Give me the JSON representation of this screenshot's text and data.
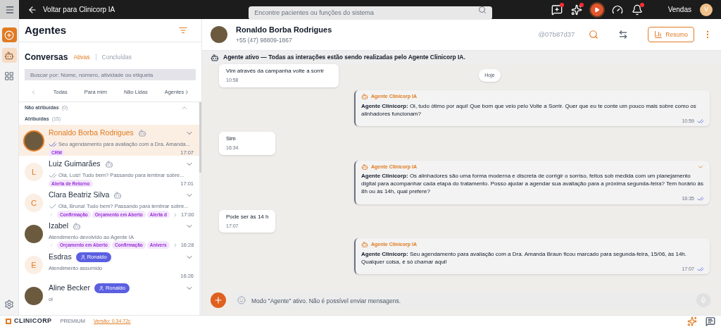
{
  "topbar": {
    "back_label": "Voltar para Clinicorp IA",
    "search_placeholder": "Encontre pacientes ou funções do sistema",
    "user": "Vendas",
    "avatar_letter": "V"
  },
  "rail": [
    {
      "kind": "agent",
      "selected": true
    },
    {
      "kind": "grid",
      "selected": false
    }
  ],
  "list": {
    "title": "Agentes",
    "section": "Conversas",
    "filters": [
      {
        "label": "Ativas",
        "selected": true
      },
      {
        "label": "Concluídas",
        "selected": false
      }
    ],
    "search_placeholder": "Buscar por: Nome, número, atividade ou etiqueta",
    "tabs": [
      {
        "label": "Todas",
        "selected": false
      },
      {
        "label": "Para mim",
        "selected": false
      },
      {
        "label": "Não Lidas",
        "selected": false
      },
      {
        "label": "Agentes",
        "selected": false
      }
    ],
    "groups": [
      {
        "label": "Não atribuídas",
        "count": "(0)",
        "expanded": false
      },
      {
        "label": "Atribuídas",
        "count": "(15)",
        "expanded": true,
        "conversations": [
          {
            "name": "Ronaldo Borba Rodrigues",
            "avatar": {
              "kind": "photo"
            },
            "agent": true,
            "status": {
              "kind": "read"
            },
            "preview": "Seu agendamento para avaliação com a Dra. Amanda...",
            "tags": [
              "CRM"
            ],
            "tags_scroll": false,
            "time": "17:07",
            "selected": true
          },
          {
            "name": "Luiz Guimarães",
            "avatar": {
              "kind": "letter",
              "letter": "L"
            },
            "agent": true,
            "status": {
              "kind": "delivered"
            },
            "preview": "Olá, Luiz! Tudo bem? Passando para lembrar sobre...",
            "tags": [
              "Alerta de Retorno"
            ],
            "tags_scroll": false,
            "time": "17:01",
            "selected": false
          },
          {
            "name": "Clara Beatriz Silva",
            "avatar": {
              "kind": "letter",
              "letter": "C"
            },
            "agent": true,
            "status": {
              "kind": "sent"
            },
            "preview": "Olá, Bruna! Tudo bem? Passando para lembrar sobre...",
            "tags": [
              "Confirmação",
              "Orçamento em Aberto",
              "Alerta d"
            ],
            "tags_scroll": true,
            "time": "17:00",
            "selected": false
          },
          {
            "name": "Izabel",
            "avatar": {
              "kind": "photo"
            },
            "agent": true,
            "preview": "Atendimento devolvido ao Agente IA",
            "tags": [
              "Orçamento em Aberto",
              "Confirmação",
              "Anivers"
            ],
            "tags_scroll": true,
            "time": "16:28",
            "selected": false
          },
          {
            "name": "Esdras",
            "avatar": {
              "kind": "letter",
              "letter": "E"
            },
            "agent": false,
            "assignee": "Ronaldo",
            "preview": "Atendimento assumido",
            "tags_scroll": false,
            "time": "16:26",
            "selected": false
          },
          {
            "name": "Aline Becker",
            "avatar": {
              "kind": "photo"
            },
            "agent": false,
            "assignee": "Ronaldo",
            "preview": "oi",
            "tags_scroll": false,
            "selected": false
          }
        ]
      }
    ]
  },
  "chat": {
    "name": "Ronaldo Borba Rodrigues",
    "phone": "+55 (47) 98809-1867",
    "handle": "@07b87d37",
    "summary_button": "Resumo",
    "banner": "Agente ativo — Todas as interações estão sendo realizadas pelo Agente Clinicorp IA.",
    "messages": [
      {
        "kind": "incoming",
        "text": "Vim  através da campanha volte a sorrir",
        "time": "10:58"
      },
      {
        "kind": "date",
        "text": "Hoje"
      },
      {
        "kind": "agent",
        "sender": "Agente Clinicorp IA",
        "text": "**Agente Clinicorp:** Oi, tudo ótimo por aqui! Que bom que veio pelo Volte a Sorrir. Quer que eu te conte um pouco mais sobre como os alinhadores funcionam?",
        "time": "10:59",
        "menu": false
      },
      {
        "kind": "incoming",
        "text": "Sim",
        "time": "16:34"
      },
      {
        "kind": "agent",
        "sender": "Agente Clinicorp IA",
        "text": "**Agente Clinicorp:** Os alinhadores são uma forma moderna e discreta de corrigir o sorriso, feitos sob medida com um planejamento digital para acompanhar cada etapa do tratamento. Posso ajudar a agendar sua avaliação para a próxima segunda-feira? Tem horário às 8h ou às 14h, qual prefere?",
        "time": "16:35",
        "menu": true
      },
      {
        "kind": "incoming",
        "text": "Pode ser às 14 h",
        "time": "17:07"
      },
      {
        "kind": "agent",
        "sender": "Agente Clinicorp IA",
        "text": "**Agente Clinicorp:** Seu agendamento para avaliação com a Dra. Amanda Braun ficou marcado para segunda-feira, 15/06, às 14h. Qualquer coisa, é só chamar aqui!",
        "time": "17:07",
        "menu": false
      }
    ],
    "input_placeholder": "Modo \"Agente\" ativo. Não é possível enviar mensagens.",
    "input_disabled": true
  },
  "footer": {
    "brand": "CLINICORP",
    "plan": "PREMIUM",
    "version": "Versão: 0.34.72c"
  }
}
